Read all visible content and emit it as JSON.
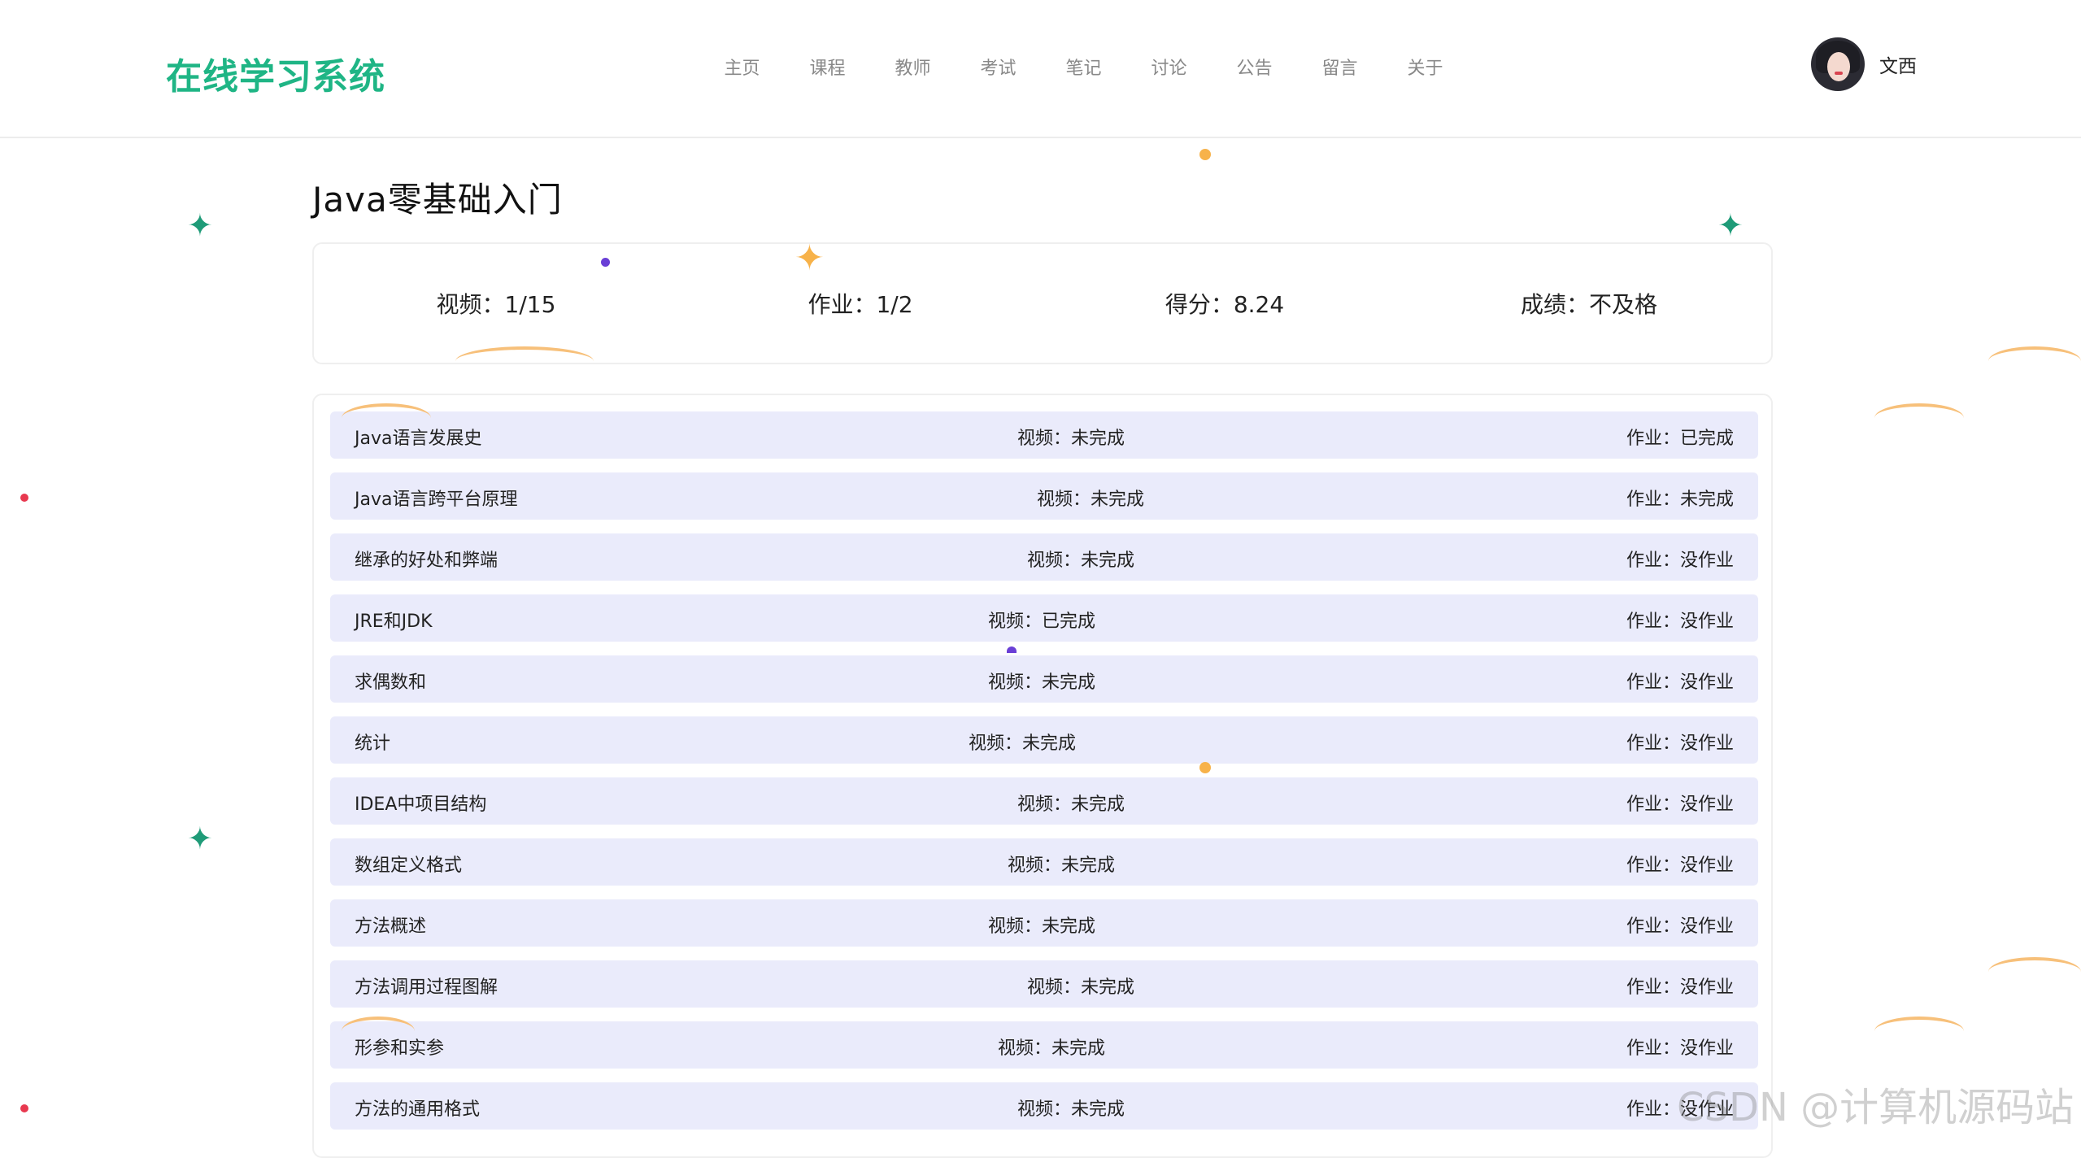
{
  "app": {
    "logo": "在线学习系统"
  },
  "nav": [
    "主页",
    "课程",
    "教师",
    "考试",
    "笔记",
    "讨论",
    "公告",
    "留言",
    "关于"
  ],
  "user": {
    "name": "文西"
  },
  "course": {
    "title": "Java零基础入门",
    "stats": {
      "video": "视频：1/15",
      "homework": "作业：1/2",
      "score": "得分：8.24",
      "grade": "成绩：不及格"
    }
  },
  "lessons": [
    {
      "name": "Java语言发展史",
      "video": "视频：未完成",
      "homework": "作业：已完成"
    },
    {
      "name": "Java语言跨平台原理",
      "video": "视频：未完成",
      "homework": "作业：未完成"
    },
    {
      "name": "继承的好处和弊端",
      "video": "视频：未完成",
      "homework": "作业：没作业"
    },
    {
      "name": "JRE和JDK",
      "video": "视频：已完成",
      "homework": "作业：没作业"
    },
    {
      "name": "求偶数和",
      "video": "视频：未完成",
      "homework": "作业：没作业"
    },
    {
      "name": "统计",
      "video": "视频：未完成",
      "homework": "作业：没作业"
    },
    {
      "name": "IDEA中项目结构",
      "video": "视频：未完成",
      "homework": "作业：没作业"
    },
    {
      "name": "数组定义格式",
      "video": "视频：未完成",
      "homework": "作业：没作业"
    },
    {
      "name": "方法概述",
      "video": "视频：未完成",
      "homework": "作业：没作业"
    },
    {
      "name": "方法调用过程图解",
      "video": "视频：未完成",
      "homework": "作业：没作业"
    },
    {
      "name": "形参和实参",
      "video": "视频：未完成",
      "homework": "作业：没作业"
    },
    {
      "name": "方法的通用格式",
      "video": "视频：未完成",
      "homework": "作业：没作业"
    }
  ],
  "watermark": "CSDN @计算机源码站",
  "colors": {
    "brand": "#1fb585",
    "row_bg": "#eaebfb"
  }
}
